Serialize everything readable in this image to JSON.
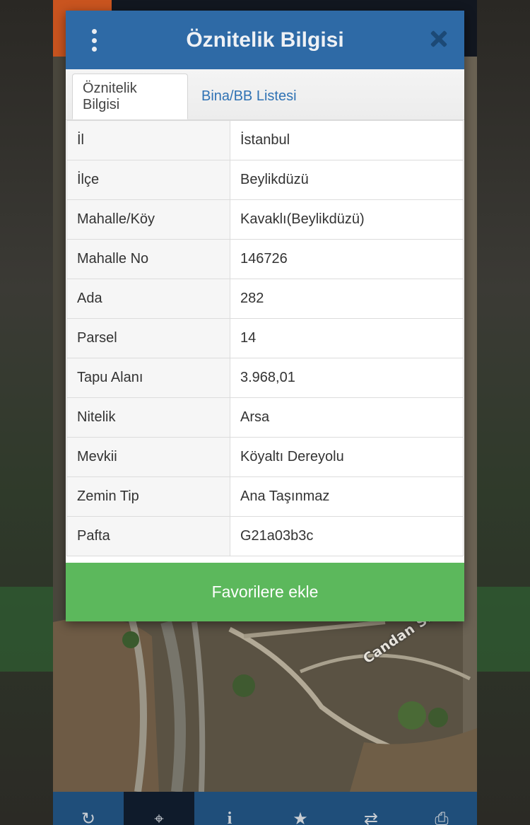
{
  "dialog": {
    "title": "Öznitelik Bilgisi",
    "tabs": [
      {
        "label": "Öznitelik Bilgisi",
        "active": true
      },
      {
        "label": "Bina/BB Listesi",
        "active": false
      }
    ],
    "rows": [
      {
        "key": "İl",
        "value": "İstanbul"
      },
      {
        "key": "İlçe",
        "value": "Beylikdüzü"
      },
      {
        "key": "Mahalle/Köy",
        "value": "Kavaklı(Beylikdüzü)"
      },
      {
        "key": "Mahalle No",
        "value": "146726"
      },
      {
        "key": "Ada",
        "value": "282"
      },
      {
        "key": "Parsel",
        "value": "14"
      },
      {
        "key": "Tapu Alanı",
        "value": "3.968,01"
      },
      {
        "key": "Nitelik",
        "value": "Arsa"
      },
      {
        "key": "Mevkii",
        "value": "Köyaltı Dereyolu"
      },
      {
        "key": "Zemin Tip",
        "value": "Ana Taşınmaz"
      },
      {
        "key": "Pafta",
        "value": "G21a03b3c"
      }
    ],
    "favorite_button": "Favorilere ekle"
  },
  "map": {
    "street_label": "Candan Sk"
  },
  "toolbar": {
    "buttons": [
      {
        "icon": "refresh-icon",
        "glyph": "↻"
      },
      {
        "icon": "crosshair-icon",
        "glyph": "⌖"
      },
      {
        "icon": "info-icon",
        "glyph": "i"
      },
      {
        "icon": "star-icon",
        "glyph": "★"
      },
      {
        "icon": "swap-arrows-icon",
        "glyph": "⇄"
      },
      {
        "icon": "print-icon",
        "glyph": "⎙"
      }
    ]
  },
  "colors": {
    "header": "#2e6aa6",
    "tab_link": "#2f72b4",
    "favorite_button": "#5cb85c",
    "toolbar": "#1f4e7a"
  }
}
